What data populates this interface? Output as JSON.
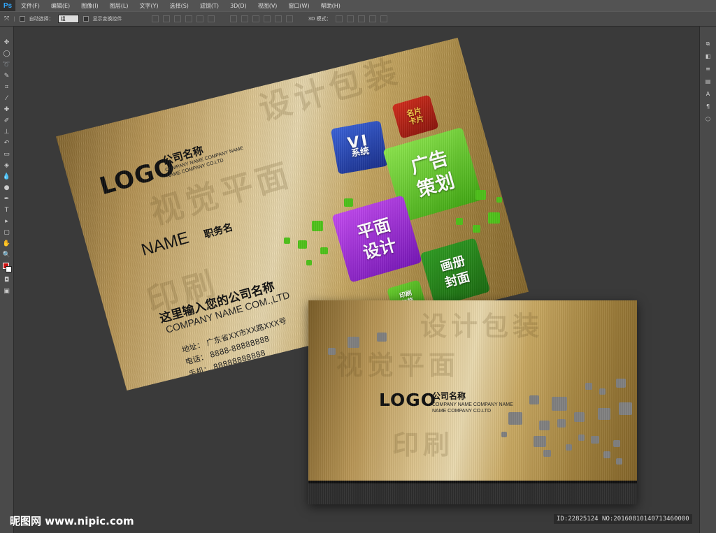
{
  "app": {
    "logo": "Ps"
  },
  "menu": [
    "文件(F)",
    "编辑(E)",
    "图像(I)",
    "图层(L)",
    "文字(Y)",
    "选择(S)",
    "滤镜(T)",
    "3D(D)",
    "视图(V)",
    "窗口(W)",
    "帮助(H)"
  ],
  "options": {
    "auto_select_label": "自动选择：",
    "auto_select_value": "组",
    "show_transform_label": "显示变换控件",
    "mode_3d_label": "3D 模式："
  },
  "front_card": {
    "logo": "LOGO",
    "company_cn": "公司名称",
    "company_en_1": "COMPANY NAME COMPANY NAME",
    "company_en_2": "NAME COMPANY CO.LTD",
    "name": "NAME",
    "title": "职务名",
    "company_main": "这里输入您的公司名称",
    "company_main_en": "COMPANY NAME COM.,LTD",
    "address": "地址：  广东省XX市XX路XXX号",
    "phone": "电话：  8888-88888888",
    "mobile": "手机：  88888888888",
    "cube_vi_1": "VI",
    "cube_vi_2": "系统",
    "cube_ad_1": "广告",
    "cube_ad_2": "策划",
    "cube_card_1": "名片",
    "cube_card_2": "卡片",
    "cube_print_1": "平面",
    "cube_print_2": "设计",
    "cube_album_1": "画册",
    "cube_album_2": "封面",
    "cube_yin_1": "印刷",
    "cube_yin_2": "包装"
  },
  "back_card": {
    "logo": "LOGO",
    "company_cn": "公司名称",
    "company_en_1": "COMPANY NAME COMPANY NAME",
    "company_en_2": "NAME COMPANY CO.LTD"
  },
  "watermark_words": [
    "设计包装",
    "视觉平面",
    "印刷",
    "广告",
    "画册"
  ],
  "footer": {
    "site": "昵图网 www.nipic.com",
    "id": "ID:22825124 NO:20160810140713460000"
  },
  "colors": {
    "accent_green": "#4fc21b",
    "accent_purple": "#9b2bd6",
    "accent_blue": "#1d3fae",
    "accent_red": "#b3231b"
  }
}
